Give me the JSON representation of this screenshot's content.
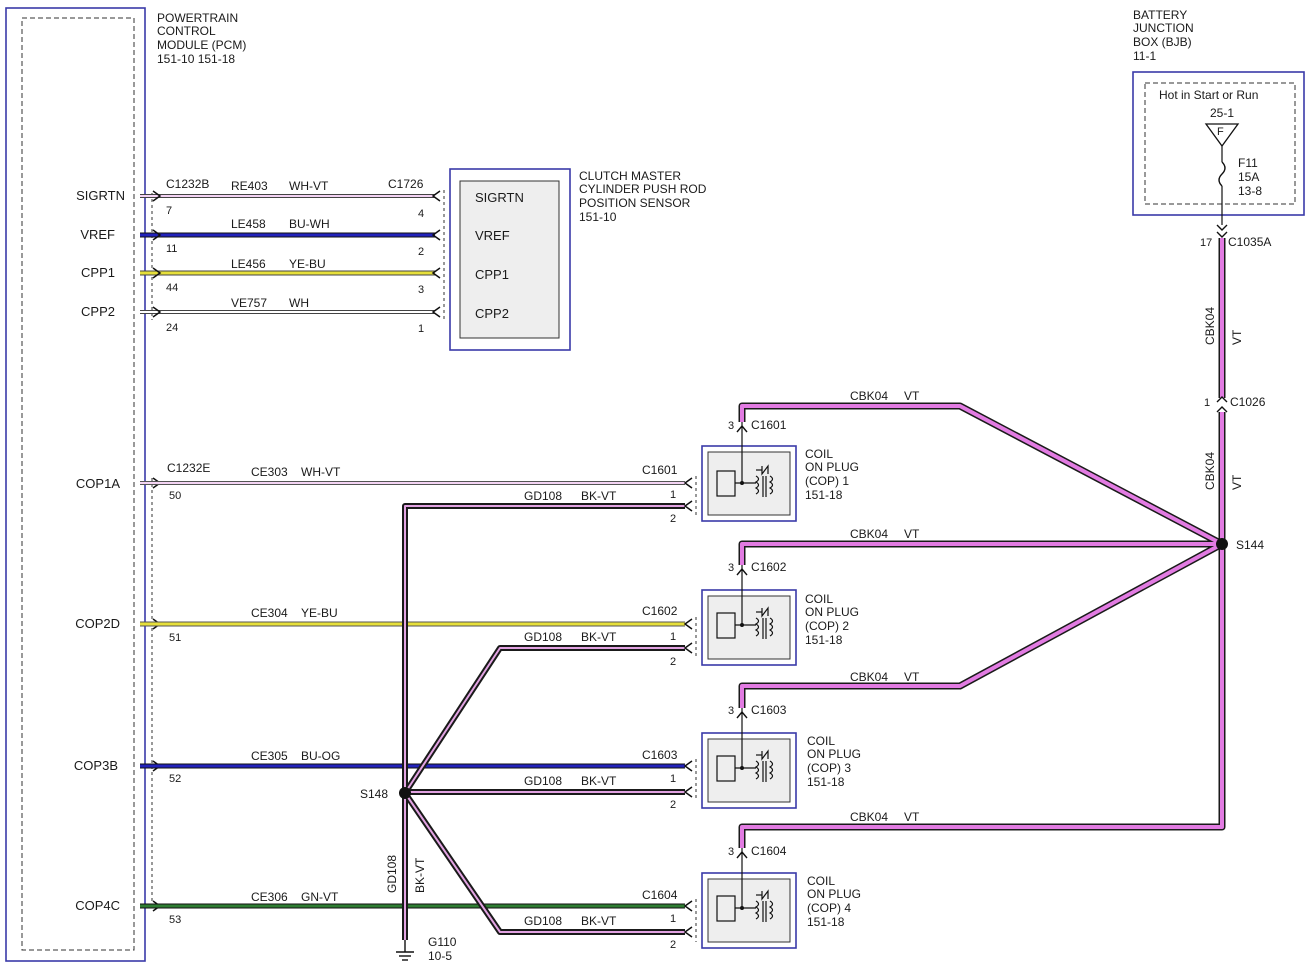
{
  "pcm": {
    "title": [
      "POWERTRAIN",
      "CONTROL",
      "MODULE (PCM)",
      "151-10  151-18"
    ],
    "pins": [
      "SIGRTN",
      "VREF",
      "CPP1",
      "CPP2",
      "COP1A",
      "COP2D",
      "COP3B",
      "COP4C"
    ]
  },
  "bjb": {
    "title": [
      "BATTERY",
      "JUNCTION",
      "BOX (BJB)",
      "11-1"
    ],
    "hot_label": "Hot in Start or Run",
    "fuse_pin": "25-1",
    "fuse_letter": "F",
    "fuse_lines": [
      "F11",
      "15A",
      "13-8"
    ],
    "connector_pin": "17",
    "connector": "C1035A"
  },
  "cpp_sensor": {
    "title": [
      "CLUTCH MASTER",
      "CYLINDER PUSH ROD",
      "POSITION SENSOR",
      "151-10"
    ],
    "pins": [
      "SIGRTN",
      "VREF",
      "CPP1",
      "CPP2"
    ],
    "connector": "C1726"
  },
  "cpp_wires": [
    {
      "circuit": "RE403",
      "color": "WH-VT",
      "pcm_pin": "7",
      "sensor_pin": "4"
    },
    {
      "circuit": "LE458",
      "color": "BU-WH",
      "pcm_pin": "11",
      "sensor_pin": "2"
    },
    {
      "circuit": "LE456",
      "color": "YE-BU",
      "pcm_pin": "44",
      "sensor_pin": "3"
    },
    {
      "circuit": "VE757",
      "color": "WH",
      "pcm_pin": "24",
      "sensor_pin": "1"
    }
  ],
  "pcm_connectors": [
    "C1232B",
    "C1232E"
  ],
  "cop_wires": [
    {
      "circuit": "CE303",
      "color": "WH-VT",
      "pcm_pin": "50"
    },
    {
      "circuit": "CE304",
      "color": "YE-BU",
      "pcm_pin": "51"
    },
    {
      "circuit": "CE305",
      "color": "BU-OG",
      "pcm_pin": "52"
    },
    {
      "circuit": "CE306",
      "color": "GN-VT",
      "pcm_pin": "53"
    }
  ],
  "coils": [
    {
      "title": [
        "COIL",
        "ON PLUG",
        "(COP) 1",
        "151-18"
      ],
      "connector": "C1601",
      "pins": [
        "1",
        "2",
        "3"
      ]
    },
    {
      "title": [
        "COIL",
        "ON PLUG",
        "(COP) 2",
        "151-18"
      ],
      "connector": "C1602",
      "pins": [
        "1",
        "2",
        "3"
      ]
    },
    {
      "title": [
        "COIL",
        "ON PLUG",
        "(COP) 3",
        "151-18"
      ],
      "connector": "C1603",
      "pins": [
        "1",
        "2",
        "3"
      ]
    },
    {
      "title": [
        "COIL",
        "ON PLUG",
        "(COP) 4",
        "151-18"
      ],
      "connector": "C1604",
      "pins": [
        "1",
        "2",
        "3"
      ]
    }
  ],
  "ground_wire": {
    "circuit": "GD108",
    "color": "BK-VT"
  },
  "power_wire": {
    "circuit": "CBK04",
    "color": "VT"
  },
  "c1026": {
    "pin": "1",
    "connector": "C1026"
  },
  "splices": {
    "power": "S144",
    "ground": "S148"
  },
  "ground": {
    "name": "G110",
    "ref": "10-5"
  },
  "colors": {
    "pink": "#e27be2",
    "blue": "#2222bb",
    "yellow": "#e6df3a",
    "green": "#2e7d32",
    "black": "#1a1a1a",
    "box_border": "#3a3aa8",
    "component_fill": "#eeeeee"
  }
}
